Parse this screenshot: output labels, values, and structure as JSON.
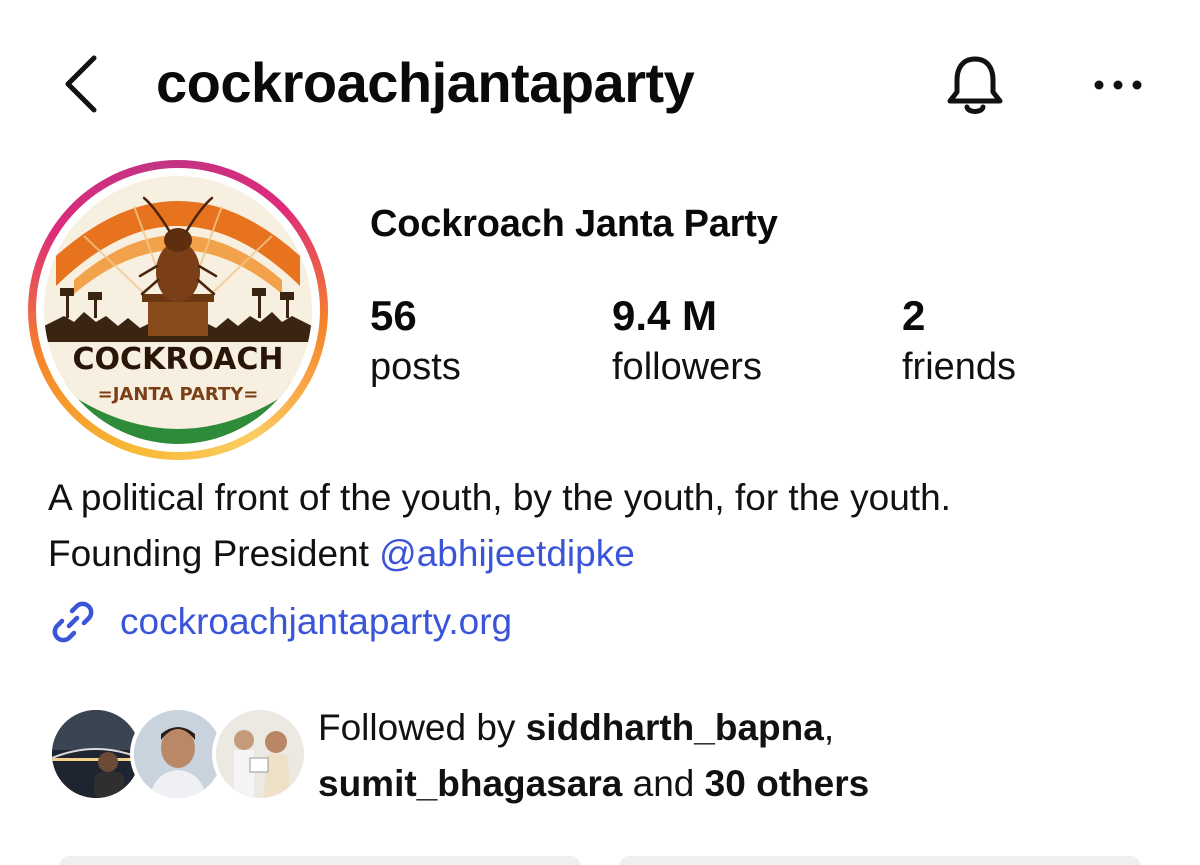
{
  "header": {
    "username": "cockroachjantaparty",
    "back_icon": "chevron-left-icon",
    "bell_icon": "bell-icon",
    "more_icon": "more-horizontal-icon"
  },
  "avatar": {
    "logo_line1": "COCKROACH",
    "logo_line2": "=JANTA PARTY="
  },
  "profile": {
    "display_name": "Cockroach Janta Party",
    "stats": [
      {
        "value": "56",
        "label": "posts"
      },
      {
        "value": "9.4 M",
        "label": "followers"
      },
      {
        "value": "2",
        "label": "friends"
      }
    ]
  },
  "bio": {
    "line1": "A political front of the youth, by the youth, for the youth.",
    "line2_prefix": "Founding President ",
    "mention": "@abhijeetdipke",
    "link_icon": "link-icon",
    "link": "cockroachjantaparty.org"
  },
  "followed_by": {
    "prefix": "Followed by ",
    "user1": "siddharth_bapna",
    "comma": ",",
    "user2": "sumit_bhagasara",
    "and_text": " and ",
    "others": "30 others"
  },
  "colors": {
    "link_blue": "#3b55d9",
    "ring_orange": "#f58529",
    "ring_pink": "#dd2a7b",
    "saffron": "#e8731e",
    "green": "#2e8b3a"
  }
}
